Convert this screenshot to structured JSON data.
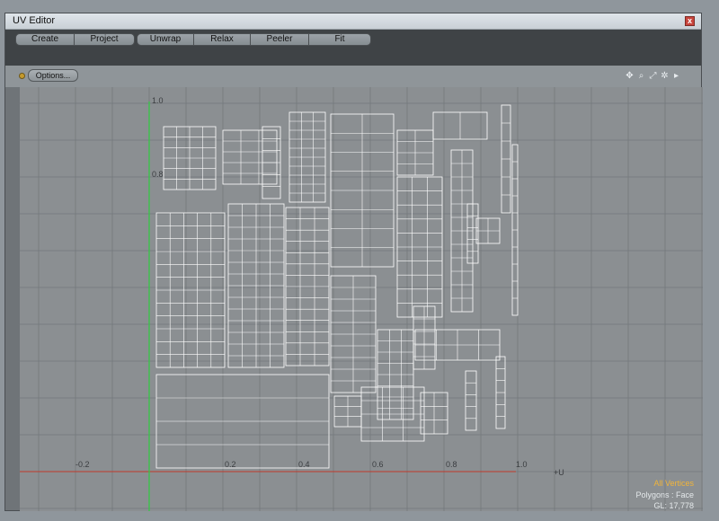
{
  "window": {
    "title": "UV Editor",
    "close_glyph": "x"
  },
  "toolbar": {
    "groups": [
      [
        "Create",
        "Project"
      ],
      [
        "Unwrap",
        "Relax",
        "Peeler",
        "Fit"
      ]
    ]
  },
  "viewbar": {
    "options_label": "Options...",
    "icons": [
      "move-view-icon",
      "zoom-icon",
      "fit-view-icon",
      "gear-icon",
      "arrow-right-icon"
    ]
  },
  "axes": {
    "v_top": "1.0",
    "v_mid": "0.8",
    "u_ticks": [
      "-0.2",
      "0.2",
      "0.4",
      "0.6",
      "0.8",
      "1.0"
    ],
    "u_label": "+U"
  },
  "status": {
    "selection": "All Vertices",
    "mode": "Polygons : Face",
    "gl": "GL: 17,778"
  },
  "colors": {
    "accent": "#f0b43a",
    "u_axis": "#c0392b",
    "v_axis": "#2ecc40",
    "uv_wire": "#ffffff"
  }
}
